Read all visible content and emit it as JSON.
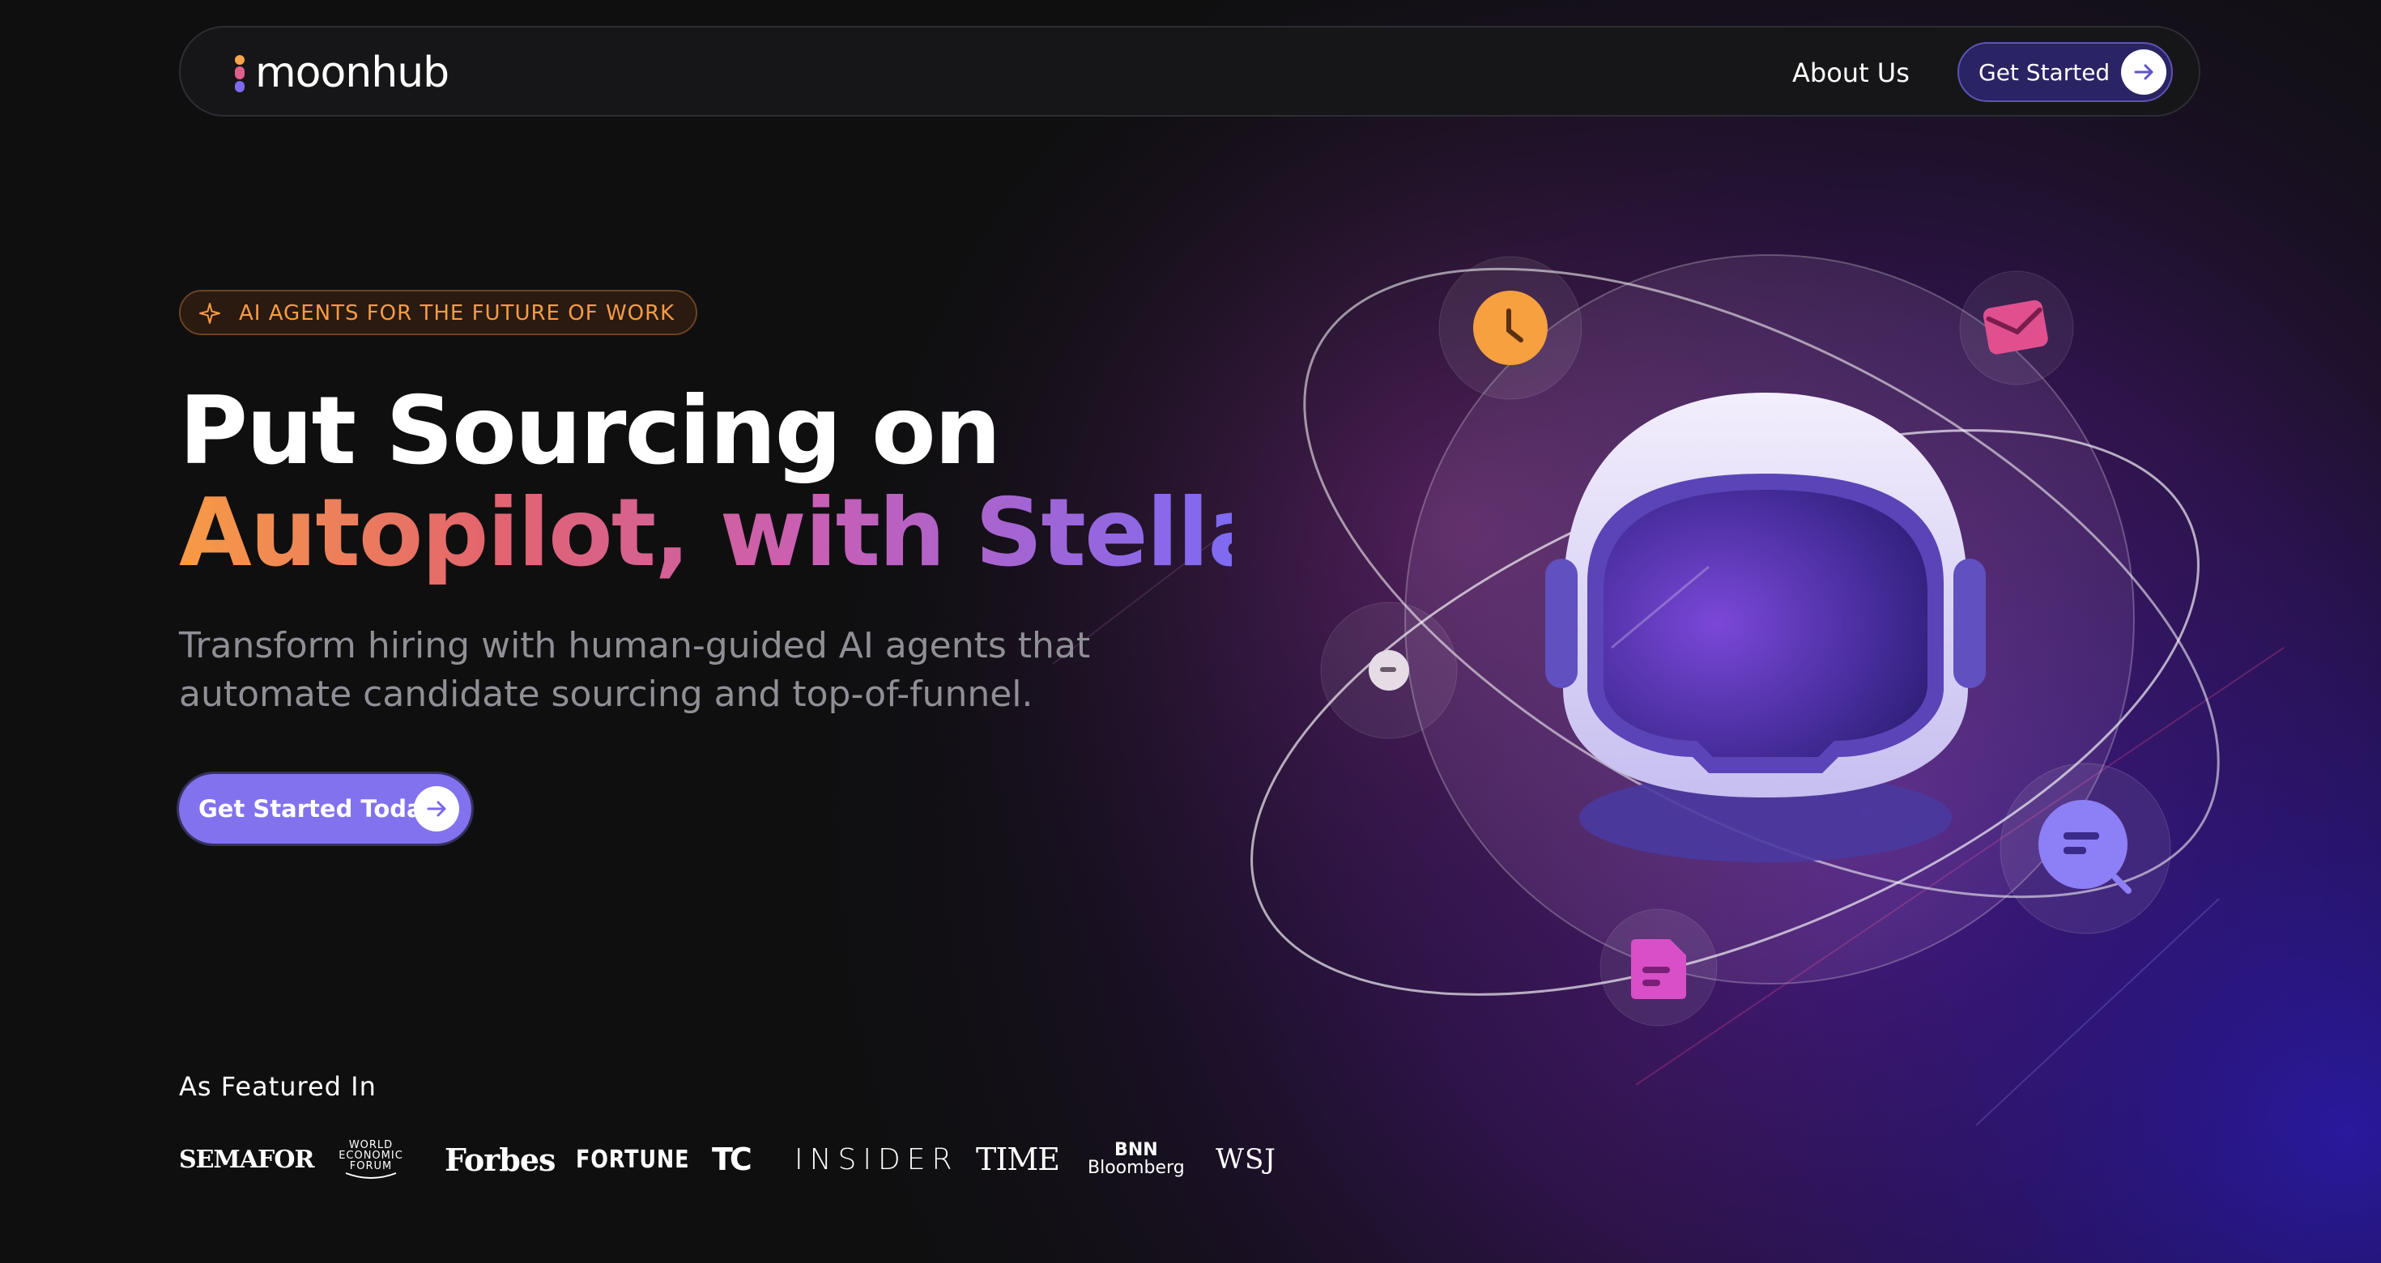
{
  "nav": {
    "brand": "moonhub",
    "about_label": "About Us",
    "cta_label": "Get Started"
  },
  "hero": {
    "badge": "AI AGENTS FOR THE FUTURE OF WORK",
    "title_line1": "Put Sourcing on",
    "title_line2": "Autopilot, with Stella",
    "subtitle_line1": "Transform hiring with human-guided AI agents that",
    "subtitle_line2": "automate candidate sourcing and top-of-funnel.",
    "cta_label": "Get Started Today"
  },
  "illustration": {
    "subject": "astronaut-helmet",
    "orbit_icons": [
      "clock-icon",
      "mail-icon",
      "chat-icon",
      "search-list-icon",
      "document-icon"
    ]
  },
  "featured": {
    "title": "As Featured In",
    "logos": [
      {
        "name": "semafor",
        "text": "SEMAFOR"
      },
      {
        "name": "world-economic-forum",
        "lines": [
          "WORLD",
          "ECONOMIC",
          "FORUM"
        ]
      },
      {
        "name": "forbes",
        "text": "Forbes"
      },
      {
        "name": "fortune",
        "text": "FORTUNE"
      },
      {
        "name": "techcrunch",
        "text": "TC"
      },
      {
        "name": "insider",
        "text": "INSIDER"
      },
      {
        "name": "time",
        "text": "TIME"
      },
      {
        "name": "bnn-bloomberg",
        "lines": [
          "BNN",
          "Bloomberg"
        ]
      },
      {
        "name": "wsj",
        "text": "WSJ"
      }
    ]
  },
  "colors": {
    "background": "#0f0f10",
    "accent_purple": "#8272ee",
    "accent_orange": "#f79b45",
    "accent_pink": "#d94fc0"
  }
}
